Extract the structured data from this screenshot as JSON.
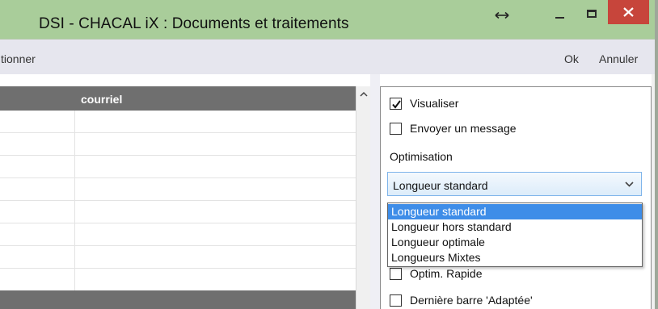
{
  "window": {
    "title": "DSI - CHACAL iX : Documents et traitements",
    "resize_icon": "horizontal-resize-arrows",
    "close_icon": "close-x"
  },
  "menu": {
    "left_item": "tionner",
    "ok": "Ok",
    "cancel": "Annuler"
  },
  "grid": {
    "columns": [
      "courriel"
    ],
    "scroll_icon": "chevron-up"
  },
  "options": {
    "visualiser": {
      "label": "Visualiser",
      "checked": true
    },
    "envoyer": {
      "label": "Envoyer un message",
      "checked": false
    },
    "optimisation_label": "Optimisation",
    "combo": {
      "value": "Longueur standard",
      "options": [
        "Longueur standard",
        "Longueur hors standard",
        "Longueur optimale",
        "Longueurs Mixtes"
      ],
      "selected_index": 0
    },
    "optim_rapide": {
      "label": "Optim. Rapide",
      "checked": false
    },
    "derniere_barre": {
      "label": "Dernière barre 'Adaptée'",
      "checked": false
    }
  },
  "colors": {
    "titlebar": "#a9cd9a",
    "close": "#c7453b",
    "grid_header": "#6f6f6f",
    "selection": "#3e8de8"
  }
}
